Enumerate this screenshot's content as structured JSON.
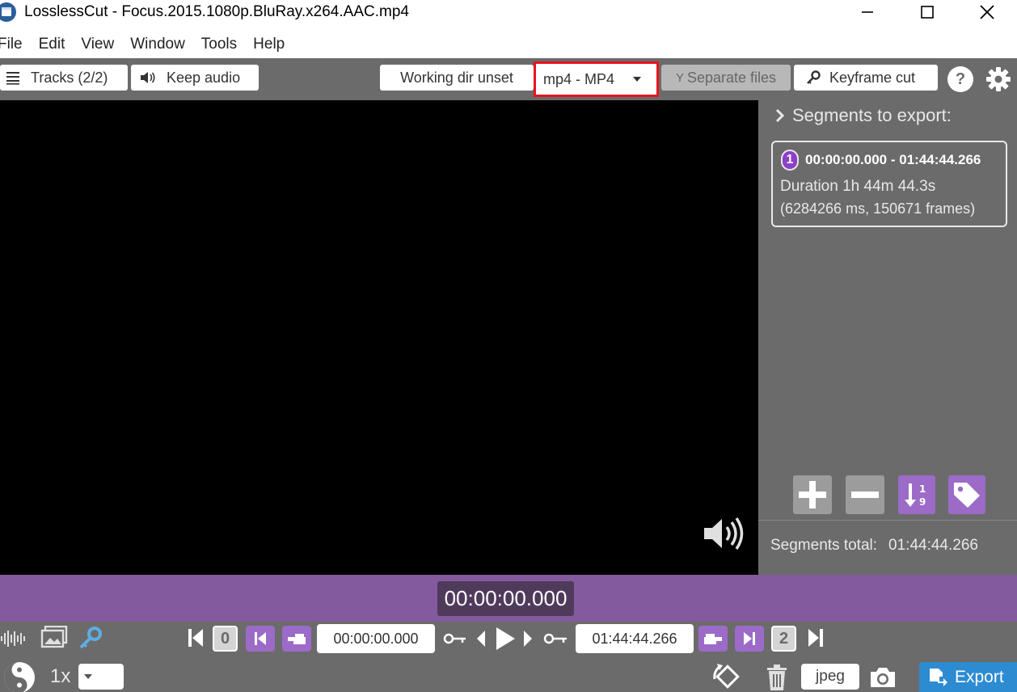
{
  "window": {
    "title": "LosslessCut - Focus.2015.1080p.BluRay.x264.AAC.mp4"
  },
  "menu": [
    "File",
    "Edit",
    "View",
    "Window",
    "Tools",
    "Help"
  ],
  "toolbar": {
    "tracks_label": "Tracks (2/2)",
    "keep_audio_label": "Keep audio",
    "working_dir_label": "Working dir unset",
    "format_value": "mp4 - MP4",
    "separate_files_label": "Separate files",
    "keyframe_cut_label": "Keyframe cut"
  },
  "segments": {
    "header": "Segments to export:",
    "items": [
      {
        "number": "1",
        "range": "00:00:00.000 - 01:44:44.266",
        "duration": "Duration 1h 44m 44.3s",
        "detail": "(6284266 ms, 150671 frames)"
      }
    ],
    "total_label": "Segments total:",
    "total_value": "01:44:44.266"
  },
  "timeline": {
    "current_time": "00:00:00.000"
  },
  "controls": {
    "start_marker": "0",
    "end_marker": "2",
    "cut_start": "00:00:00.000",
    "cut_end": "01:44:44.266",
    "speed": "1x",
    "capture_format": "jpeg",
    "export_label": "Export"
  },
  "colors": {
    "accent_purple": "#9b6bc7",
    "timeline_purple": "#845a9e",
    "export_blue": "#2d8bd2",
    "highlight_red": "#e8141d"
  }
}
